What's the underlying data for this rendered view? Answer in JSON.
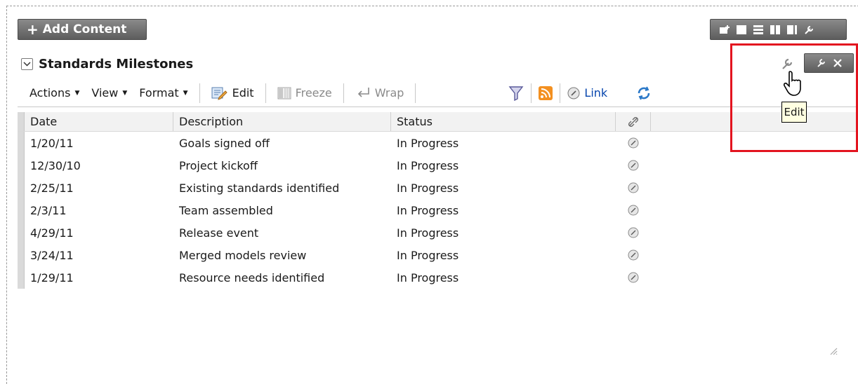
{
  "add_content": {
    "label": "Add Content"
  },
  "region": {
    "title": "Standards Milestones"
  },
  "toolbar": {
    "actions": "Actions",
    "view": "View",
    "format": "Format",
    "edit": "Edit",
    "freeze": "Freeze",
    "wrap": "Wrap",
    "link": "Link"
  },
  "tooltip": {
    "text": "Edit"
  },
  "table": {
    "columns": [
      "Date",
      "Description",
      "Status"
    ],
    "rows": [
      {
        "date": "1/20/11",
        "description": "Goals signed off",
        "status": "In Progress"
      },
      {
        "date": "12/30/10",
        "description": "Project kickoff",
        "status": "In Progress"
      },
      {
        "date": "2/25/11",
        "description": "Existing standards identified",
        "status": "In Progress"
      },
      {
        "date": "2/3/11",
        "description": "Team assembled",
        "status": "In Progress"
      },
      {
        "date": "4/29/11",
        "description": "Release event",
        "status": "In Progress"
      },
      {
        "date": "3/24/11",
        "description": "Merged models review",
        "status": "In Progress"
      },
      {
        "date": "1/29/11",
        "description": "Resource needs identified",
        "status": "In Progress"
      }
    ]
  },
  "colors": {
    "highlight": "#e3141f",
    "toolbar_button": "#6f6f6f",
    "link": "#0645ad",
    "tooltip_bg": "#ffffe1"
  },
  "icons": {
    "edit": "edit-pencil-icon",
    "freeze": "freeze-columns-icon",
    "wrap": "wrap-arrow-icon",
    "filter": "filter-funnel-icon",
    "rss": "rss-feed-icon",
    "link": "chain-link-icon",
    "refresh": "refresh-icon",
    "wrench": "wrench-icon",
    "close": "close-icon"
  }
}
